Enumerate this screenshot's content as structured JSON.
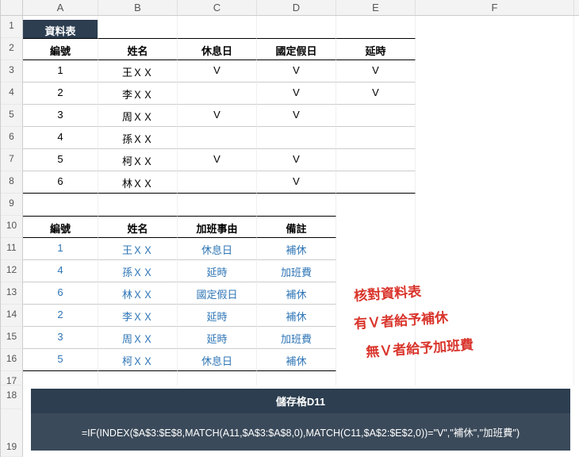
{
  "columns": [
    "A",
    "B",
    "C",
    "D",
    "E",
    "F"
  ],
  "rows": [
    "1",
    "2",
    "3",
    "4",
    "5",
    "6",
    "7",
    "8",
    "9",
    "10",
    "11",
    "12",
    "13",
    "14",
    "15",
    "16",
    "17",
    "18",
    "19"
  ],
  "tab_label": "資料表",
  "table1": {
    "headers": [
      "編號",
      "姓名",
      "休息日",
      "國定假日",
      "延時"
    ],
    "rows": [
      {
        "id": "1",
        "name": "王ＸＸ",
        "c": "V",
        "d": "V",
        "e": "V"
      },
      {
        "id": "2",
        "name": "李ＸＸ",
        "c": "",
        "d": "V",
        "e": "V"
      },
      {
        "id": "3",
        "name": "周ＸＸ",
        "c": "V",
        "d": "V",
        "e": ""
      },
      {
        "id": "4",
        "name": "孫ＸＸ",
        "c": "",
        "d": "",
        "e": ""
      },
      {
        "id": "5",
        "name": "柯ＸＸ",
        "c": "V",
        "d": "V",
        "e": ""
      },
      {
        "id": "6",
        "name": "林ＸＸ",
        "c": "",
        "d": "V",
        "e": ""
      }
    ]
  },
  "table2": {
    "headers": [
      "編號",
      "姓名",
      "加班事由",
      "備註"
    ],
    "rows": [
      {
        "id": "1",
        "name": "王ＸＸ",
        "reason": "休息日",
        "note": "補休"
      },
      {
        "id": "4",
        "name": "孫ＸＸ",
        "reason": "延時",
        "note": "加班費"
      },
      {
        "id": "6",
        "name": "林ＸＸ",
        "reason": "國定假日",
        "note": "補休"
      },
      {
        "id": "2",
        "name": "李ＸＸ",
        "reason": "延時",
        "note": "補休"
      },
      {
        "id": "3",
        "name": "周ＸＸ",
        "reason": "延時",
        "note": "加班費"
      },
      {
        "id": "5",
        "name": "柯ＸＸ",
        "reason": "休息日",
        "note": "補休"
      }
    ]
  },
  "annotations": {
    "line1": "核對資料表",
    "line2": "有Ｖ者給予補休",
    "line3": "無Ｖ者給予加班費"
  },
  "formula": {
    "title": "儲存格D11",
    "body": "=IF(INDEX($A$3:$E$8,MATCH(A11,$A$3:$A$8,0),MATCH(C11,$A$2:$E$2,0))=\"V\",\"補休\",\"加班費\")"
  }
}
